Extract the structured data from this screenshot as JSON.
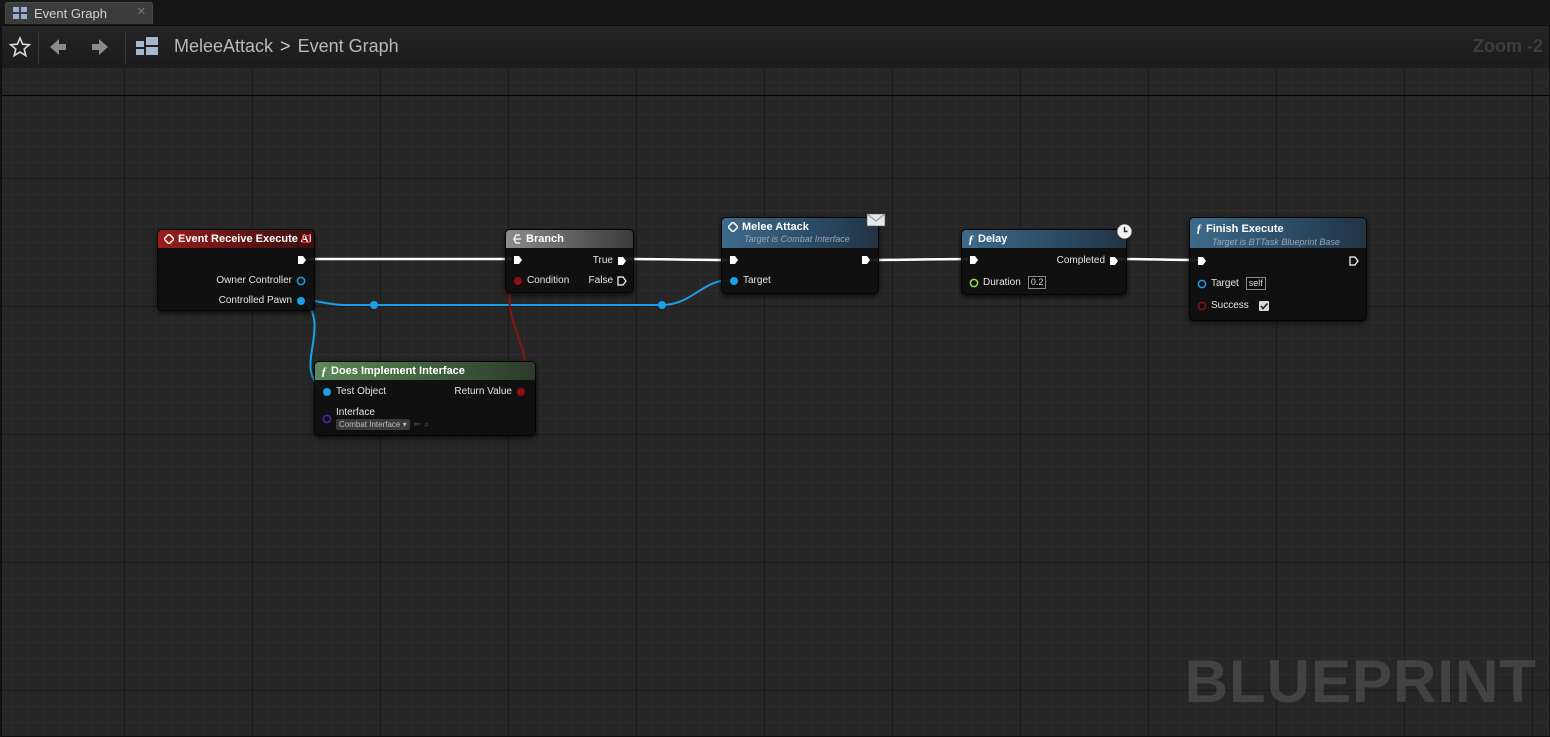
{
  "tab": {
    "label": "Event Graph",
    "close": "✕"
  },
  "toolbar": {
    "breadcrumb_root": "MeleeAttack",
    "breadcrumb_separator": ">",
    "breadcrumb_current": "Event Graph",
    "zoom": "Zoom -2"
  },
  "watermark": "BLUEPRINT",
  "nodes": {
    "event_receive": {
      "title": "Event Receive Execute AI",
      "pins": {
        "owner_controller": "Owner Controller",
        "controlled_pawn": "Controlled Pawn"
      }
    },
    "branch": {
      "title": "Branch",
      "pins": {
        "condition": "Condition",
        "true": "True",
        "false": "False"
      }
    },
    "melee_attack": {
      "title": "Melee Attack",
      "subtitle": "Target is Combat Interface",
      "pins": {
        "target": "Target"
      }
    },
    "delay": {
      "title": "Delay",
      "pins": {
        "duration": "Duration",
        "duration_value": "0.2",
        "completed": "Completed"
      }
    },
    "finish_execute": {
      "title": "Finish Execute",
      "subtitle": "Target is BTTask Blueprint Base",
      "pins": {
        "target": "Target",
        "target_value": "self",
        "success": "Success",
        "success_checked": true
      }
    },
    "does_implement": {
      "title": "Does Implement Interface",
      "pins": {
        "test_object": "Test Object",
        "return_value": "Return Value",
        "interface": "Interface",
        "interface_value": "Combat Interface"
      }
    }
  },
  "colors": {
    "exec": "#ffffff",
    "object": "#1aa0e8",
    "bool": "#8e1010",
    "float": "#9ee040",
    "interface": "#5a1fb0"
  }
}
